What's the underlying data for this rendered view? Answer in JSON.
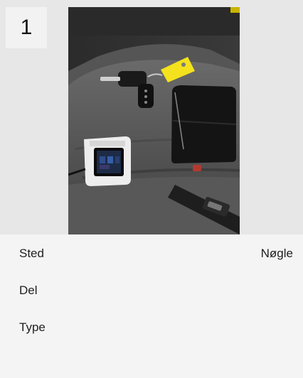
{
  "card": {
    "number": "1",
    "photo_alt": "Car seat with keys and device",
    "fields": [
      {
        "label": "Sted",
        "value": "Nøgle"
      },
      {
        "label": "Del",
        "value": ""
      },
      {
        "label": "Type",
        "value": ""
      }
    ]
  }
}
